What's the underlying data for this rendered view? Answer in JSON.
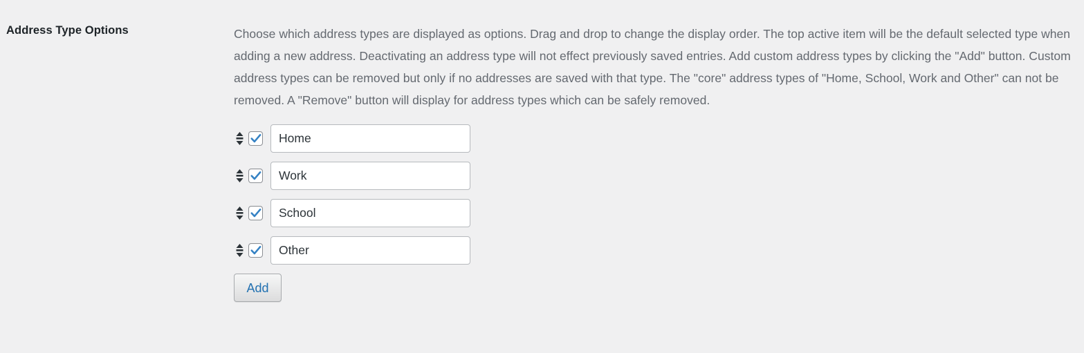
{
  "field": {
    "label": "Address Type Options",
    "description": "Choose which address types are displayed as options. Drag and drop to change the display order. The top active item will be the default selected type when adding a new address. Deactivating an address type will not effect previously saved entries. Add custom address types by clicking the \"Add\" button. Custom address types can be removed but only if no addresses are saved with that type. The \"core\" address types of \"Home, School, Work and Other\" can not be removed. A \"Remove\" button will display for address types which can be safely removed."
  },
  "address_types": [
    {
      "value": "Home",
      "enabled": true
    },
    {
      "value": "Work",
      "enabled": true
    },
    {
      "value": "School",
      "enabled": true
    },
    {
      "value": "Other",
      "enabled": true
    }
  ],
  "buttons": {
    "add_label": "Add"
  },
  "icons": {
    "drag_handle": "sort-updown-icon",
    "checkbox_check": "check-icon"
  },
  "colors": {
    "page_background": "#f0f0f1",
    "label_text": "#1d2327",
    "description_text": "#646970",
    "input_border": "#b6b9bd",
    "checkbox_border": "#8c8f94",
    "check_blue": "#3582c4",
    "button_text_blue": "#2271b1",
    "button_border": "#a7aaad"
  }
}
